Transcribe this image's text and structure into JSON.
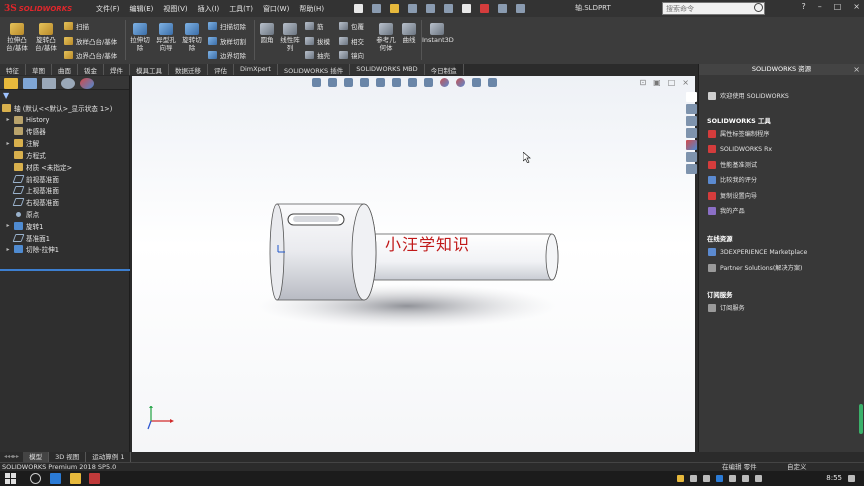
{
  "app": {
    "logo_ds": "3S",
    "logo_name": "SOLIDWORKS",
    "document_name": "轴.SLDPRT",
    "search_placeholder": "搜索命令",
    "menus": [
      "文件(F)",
      "编辑(E)",
      "视图(V)",
      "插入(I)",
      "工具(T)",
      "窗口(W)",
      "帮助(H)"
    ]
  },
  "toolbar": {
    "extrude_boss": "拉伸凸\n台/基体",
    "revolve_boss": "旋转凸\n台/基体",
    "sweep": "扫描",
    "loft_boss": "放样凸台/基体",
    "boundary_boss": "边界凸台/基体",
    "extrude_cut": "拉伸切\n除",
    "hole_wizard": "异型孔\n向导",
    "revolve_cut": "旋转切\n除",
    "sweep_cut": "扫描切除",
    "loft_cut": "放样切割",
    "boundary_cut": "边界切除",
    "fillet": "圆角",
    "linear_pattern": "线性阵\n列",
    "rib": "筋",
    "draft": "拔模",
    "shell": "抽壳",
    "wrap": "包覆",
    "intersect": "相交",
    "mirror": "镜向",
    "ref_geometry": "参考几\n何体",
    "curves": "曲线",
    "instant3d": "Instant3D"
  },
  "tabs": [
    "特征",
    "草图",
    "曲面",
    "钣金",
    "焊件",
    "模具工具",
    "数据迁移",
    "评估",
    "DimXpert",
    "SOLIDWORKS 插件",
    "SOLIDWORKS MBD",
    "今日制造"
  ],
  "tree": {
    "root": "轴 (默认<<默认>_显示状态 1>)",
    "items": [
      {
        "label": "History",
        "arrow": "▸",
        "icon": "folder"
      },
      {
        "label": "传感器",
        "arrow": "",
        "icon": "folder"
      },
      {
        "label": "注解",
        "arrow": "▸",
        "icon": "gold"
      },
      {
        "label": "方程式",
        "arrow": "",
        "icon": "gold"
      },
      {
        "label": "材质 <未指定>",
        "arrow": "",
        "icon": "gold"
      },
      {
        "label": "前视基准面",
        "arrow": "",
        "icon": "plane"
      },
      {
        "label": "上视基准面",
        "arrow": "",
        "icon": "plane"
      },
      {
        "label": "右视基准面",
        "arrow": "",
        "icon": "plane"
      },
      {
        "label": "原点",
        "arrow": "",
        "icon": "pt"
      },
      {
        "label": "旋转1",
        "arrow": "▸",
        "icon": "blue2"
      },
      {
        "label": "基准面1",
        "arrow": "",
        "icon": "plane"
      },
      {
        "label": "切除-拉伸1",
        "arrow": "▸",
        "icon": "blue2"
      }
    ]
  },
  "viewport": {
    "watermark": "小汪学知识"
  },
  "bottom_tabs": [
    "模型",
    "3D 视图",
    "运动算例 1"
  ],
  "status": {
    "version": "SOLIDWORKS Premium 2018 SP5.0",
    "mode": "在编辑 零件",
    "custom": "自定义"
  },
  "resources": {
    "title": "SOLIDWORKS 资源",
    "welcome": "欢迎使用 SOLIDWORKS",
    "tools_header": "SOLIDWORKS 工具",
    "tools": [
      "属性标签编制程序",
      "SOLIDWORKS Rx",
      "性能基准测试",
      "比较我的评分",
      "复制设置向导",
      "我的产品"
    ],
    "online_header": "在线资源",
    "online": [
      "3DEXPERIENCE Marketplace",
      "Partner Solutions(解决方案)"
    ],
    "subscription_header": "订阅服务",
    "subscription": [
      "订阅服务"
    ]
  },
  "taskbar": {
    "clock": "8:55"
  },
  "colors": {
    "accent_blue": "#3d7fd0",
    "watermark_red": "#c01818",
    "brand_red": "#e0262b"
  }
}
